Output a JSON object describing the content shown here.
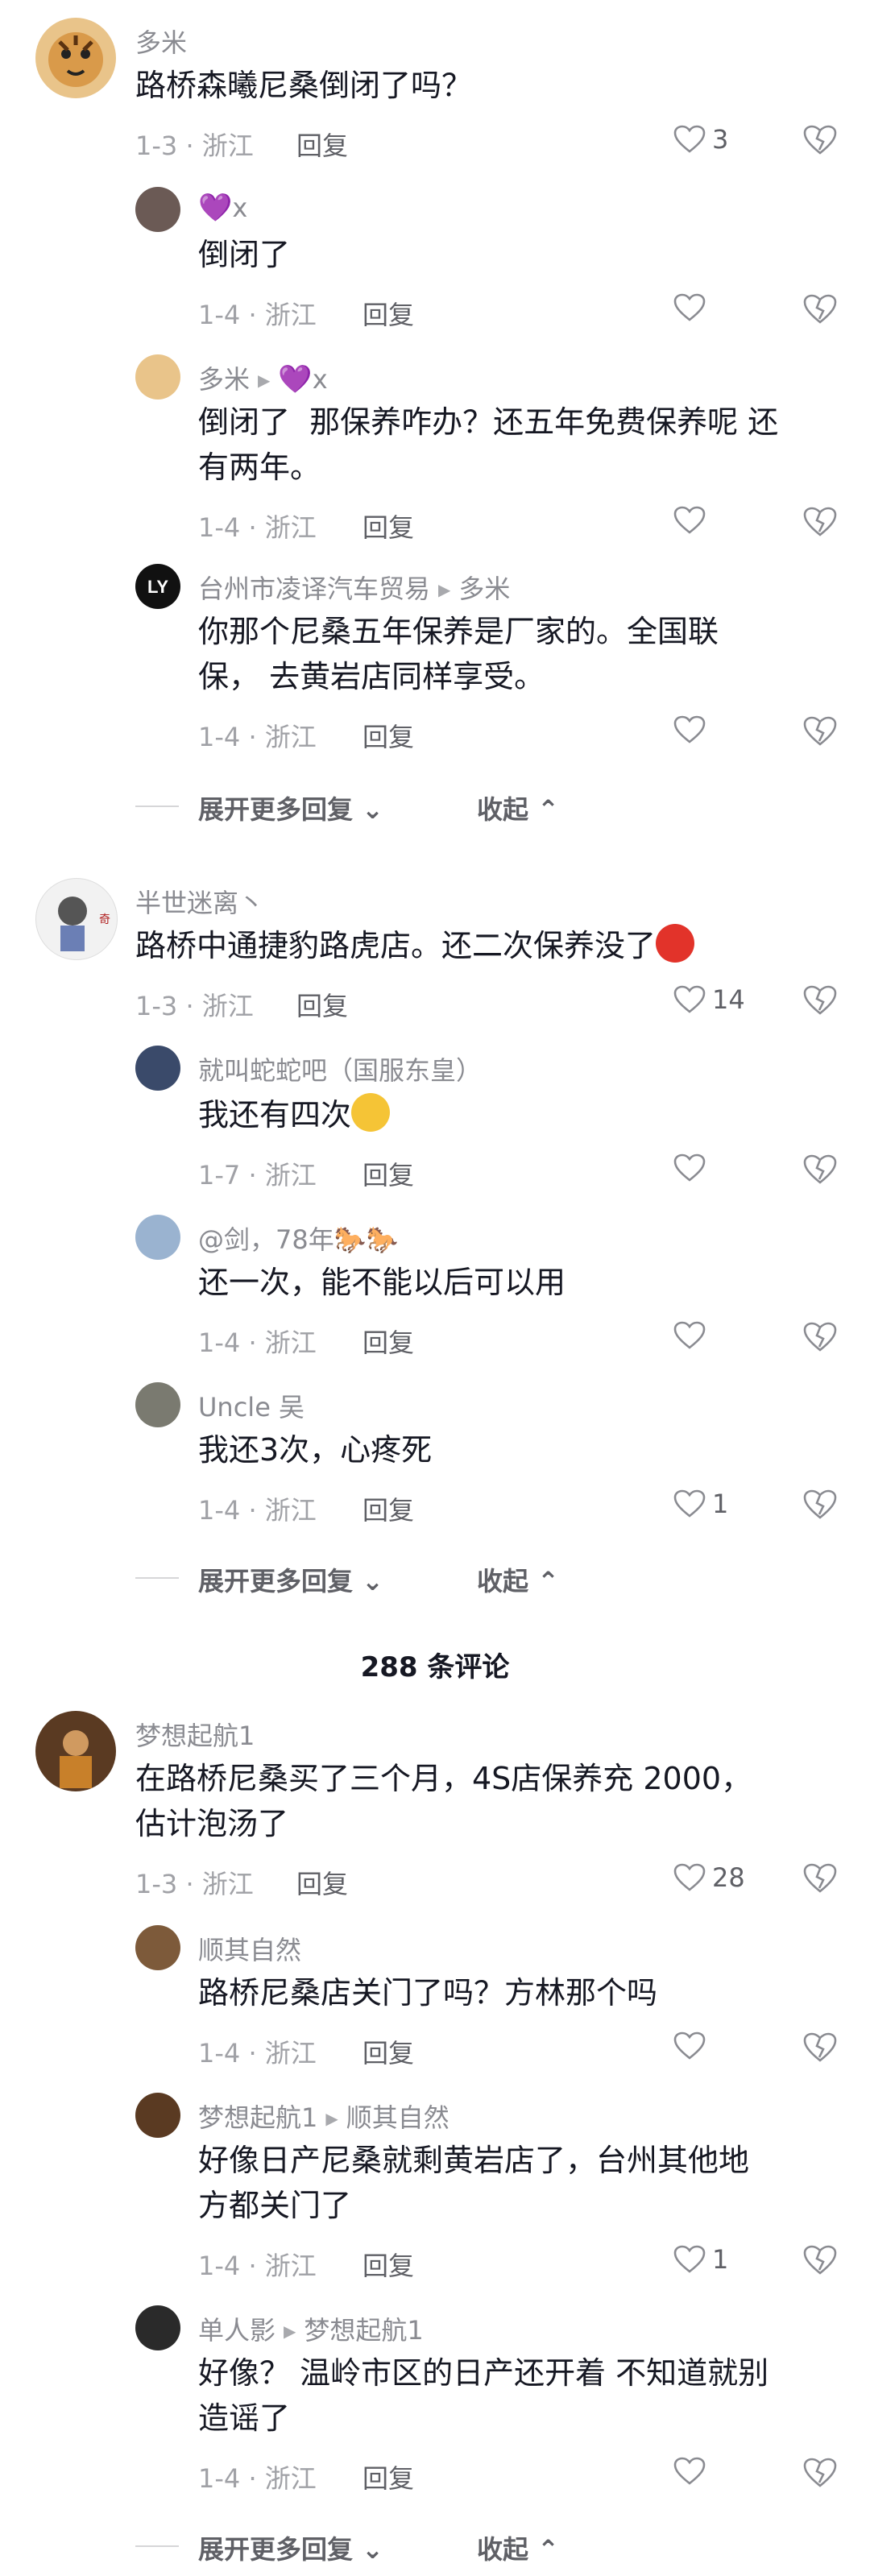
{
  "comments": [
    {
      "name": "多米",
      "text": "路桥森曦尼桑倒闭了吗？",
      "meta": "1-3 · 浙江",
      "reply": "回复",
      "likes": "3",
      "replies": [
        {
          "name": "💜x",
          "text": "倒闭了",
          "meta": "1-4 · 浙江",
          "reply": "回复",
          "likes": ""
        },
        {
          "name": "多米",
          "to": "💜x",
          "text": "倒闭了  那保养咋办？还五年免费保养呢 还\n有两年。",
          "meta": "1-4 · 浙江",
          "reply": "回复",
          "likes": ""
        },
        {
          "name": "台州市凌译汽车贸易",
          "to": "多米",
          "text": "你那个尼桑五年保养是厂家的。全国联\n保， 去黄岩店同样享受。",
          "meta": "1-4 · 浙江",
          "reply": "回复",
          "likes": ""
        }
      ],
      "expand": "展开更多回复",
      "collapse": "收起"
    },
    {
      "name": "半世迷离丶",
      "text": "路桥中通捷豹路虎店。还二次保养没了😡",
      "meta": "1-3 · 浙江",
      "reply": "回复",
      "likes": "14",
      "replies": [
        {
          "name": "就叫蛇蛇吧（国服东皇）",
          "text": "我还有四次😭",
          "meta": "1-7 · 浙江",
          "reply": "回复",
          "likes": ""
        },
        {
          "name": "@剑，78年🐎🐎",
          "text": "还一次，能不能以后可以用",
          "meta": "1-4 · 浙江",
          "reply": "回复",
          "likes": ""
        },
        {
          "name": "Uncle 吴",
          "text": "我还3次，心疼死",
          "meta": "1-4 · 浙江",
          "reply": "回复",
          "likes": "1"
        }
      ],
      "expand": "展开更多回复",
      "collapse": "收起"
    },
    {
      "name": "梦想起航1",
      "text": "在路桥尼桑买了三个月，4S店保养充 2000，\n估计泡汤了",
      "meta": "1-3 · 浙江",
      "reply": "回复",
      "likes": "28",
      "replies": [
        {
          "name": "顺其自然",
          "text": "路桥尼桑店关门了吗？方林那个吗",
          "meta": "1-4 · 浙江",
          "reply": "回复",
          "likes": ""
        },
        {
          "name": "梦想起航1",
          "to": "顺其自然",
          "text": "好像日产尼桑就剩黄岩店了，台州其他地\n方都关门了",
          "meta": "1-4 · 浙江",
          "reply": "回复",
          "likes": "1"
        },
        {
          "name": "单人影",
          "to": "梦想起航1",
          "text": "好像？ 温岭市区的日产还开着 不知道就别\n造谣了",
          "meta": "1-4 · 浙江",
          "reply": "回复",
          "likes": ""
        }
      ],
      "expand": "展开更多回复",
      "collapse": "收起"
    }
  ],
  "total_comments": "288 条评论",
  "colors": {
    "muted": "#a0a1a6",
    "text": "#161823",
    "heart_purple": "#9b3ff6"
  }
}
